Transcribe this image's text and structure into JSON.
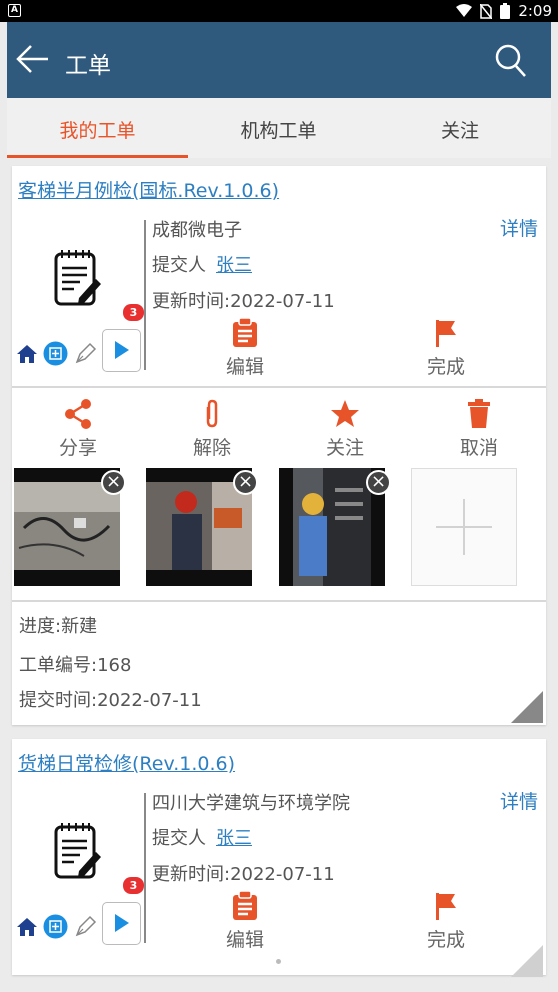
{
  "status_bar": {
    "time": "2:09"
  },
  "app_bar": {
    "title": "工单"
  },
  "tabs": [
    {
      "label": "我的工单",
      "active": true
    },
    {
      "label": "机构工单",
      "active": false
    },
    {
      "label": "关注",
      "active": false
    }
  ],
  "actions": {
    "edit": "编辑",
    "complete": "完成",
    "share": "分享",
    "unbind": "解除",
    "follow": "关注",
    "cancel": "取消",
    "detail": "详情",
    "submitter_label": "提交人"
  },
  "orders": [
    {
      "title": "客梯半月例检(国标.Rev.1.0.6)",
      "org": "成都微电子",
      "submitter": "张三",
      "updated": "更新时间:2022-07-11",
      "badge": "3",
      "progress": "进度:新建",
      "number": "工单编号:168",
      "submitted": "提交时间:2022-07-11"
    },
    {
      "title": "货梯日常检修(Rev.1.0.6)",
      "org": "四川大学建筑与环境学院",
      "submitter": "张三",
      "updated": "更新时间:2022-07-11",
      "badge": "3"
    }
  ],
  "colors": {
    "app_bar": "#2f5a7e",
    "accent": "#e8542a",
    "link": "#2d7fc2",
    "badge": "#e83030",
    "play": "#1a8ee0"
  }
}
